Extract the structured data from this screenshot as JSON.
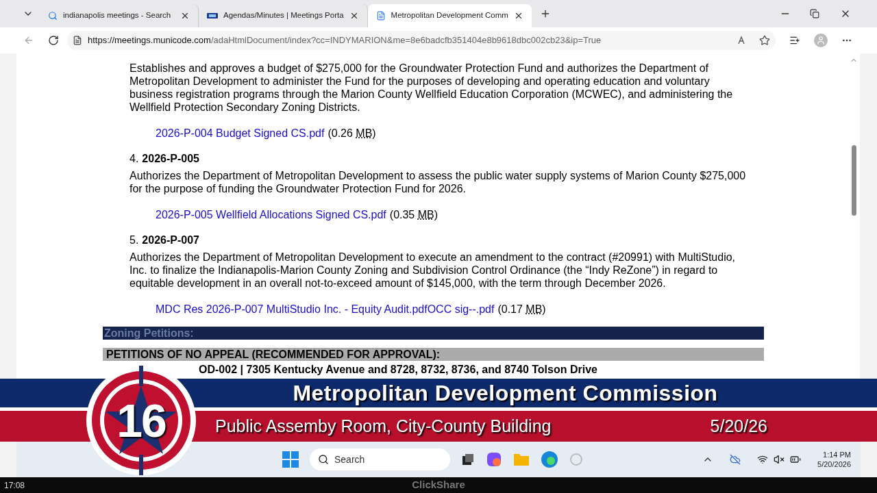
{
  "browser": {
    "tabs": [
      {
        "title": "indianapolis meetings - Search",
        "kind": "search",
        "selected": false
      },
      {
        "title": "Agendas/Minutes | Meetings Porta",
        "kind": "site",
        "selected": false
      },
      {
        "title": "Metropolitan Development Comm",
        "kind": "document",
        "selected": true
      }
    ],
    "url_host": "https://meetings.municode.com",
    "url_path": "/adaHtmlDocument/index?cc=INDYMARION&me=8e6badcfb351404e8b9618dbc002cb23&ip=True"
  },
  "document": {
    "items": [
      {
        "description": "Establishes and approves a budget of $275,000 for the Groundwater Protection Fund and authorizes the Department of Metropolitan Development to administer the Fund for the purposes of developing and operating education and voluntary business registration programs through the Marion County Wellfield Education Corporation (MCWEC), and administering the Wellfield Protection Secondary Zoning Districts.",
        "attachment": "2026-P-004 Budget Signed CS.pdf",
        "size_open": "(0.26",
        "unit": "MB",
        "size_close": ")"
      },
      {
        "number": "4.",
        "code": "2026-P-005",
        "description": "Authorizes the Department of Metropolitan Development to assess the public water supply systems of Marion County $275,000 for the purpose of funding the Groundwater Protection Fund for 2026.",
        "attachment": "2026-P-005 Wellfield Allocations Signed CS.pdf",
        "size_open": "(0.35",
        "unit": "MB",
        "size_close": ")"
      },
      {
        "number": "5.",
        "code": "2026-P-007",
        "description": "Authorizes the Department of Metropolitan Development to execute an amendment to the contract (#20991) with MultiStudio, Inc. to finalize the Indianapolis-Marion County Zoning and Subdivision Control Ordinance (the “Indy ReZone”) in regard to equitable development in an overall not-to-exceed amount of $145,000, with the term through December 2026.",
        "attachment": "MDC Res 2026-P-007 MultiStudio Inc. - Equity Audit.pdfOCC sig--.pdf",
        "size_open": "(0.17",
        "unit": "MB",
        "size_close": ")"
      }
    ],
    "section_header": "Zoning Petitions:",
    "subsection_header": "PETITIONS OF NO APPEAL (RECOMMENDED FOR APPROVAL):",
    "petition_line": "OD-002 | 7305 Kentucky Avenue and 8728, 8732, 8736, and 8740 Tolson Drive"
  },
  "overlay": {
    "channel": "16",
    "title": "Metropolitan Development Commission",
    "location": "Public Assemby Room, City-County Building",
    "date": "5/20/26"
  },
  "taskbar": {
    "search_placeholder": "Search",
    "time": "1:14 PM",
    "date": "5/20/2026"
  },
  "footer": {
    "timestamp": "17:08",
    "brand": "ClickShare"
  }
}
